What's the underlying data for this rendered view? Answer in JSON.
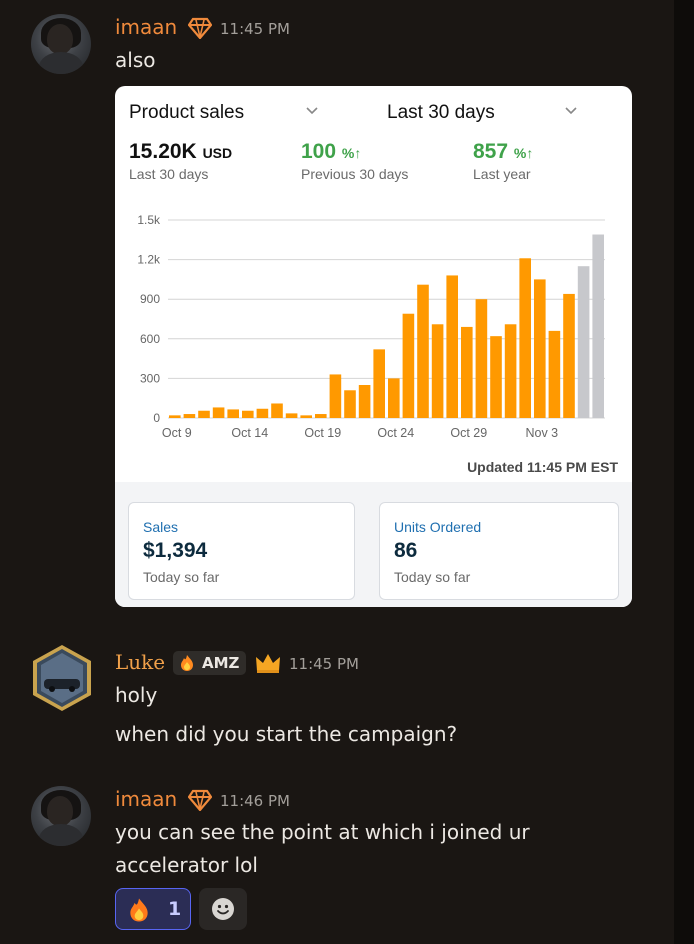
{
  "messages": [
    {
      "author": "imaan",
      "time": "11:45 PM",
      "lines": [
        "also"
      ]
    },
    {
      "author": "Luke",
      "tag": "AMZ",
      "time": "11:45 PM",
      "lines": [
        "holy",
        "when did you start the campaign?"
      ]
    },
    {
      "author": "imaan",
      "time": "11:46 PM",
      "lines": [
        "you can see the point at which i joined ur",
        "accelerator lol"
      ]
    }
  ],
  "attachment": {
    "metric_selector": "Product sales",
    "range_selector": "Last 30 days",
    "kpis": [
      {
        "value": "15.20K",
        "unit": "USD",
        "label": "Last 30 days"
      },
      {
        "value": "100",
        "unit": "%↑",
        "label": "Previous 30 days",
        "color": "#3fa24a"
      },
      {
        "value": "857",
        "unit": "%↑",
        "label": "Last year",
        "color": "#3fa24a"
      }
    ],
    "updated": "Updated 11:45 PM EST",
    "cards": [
      {
        "title": "Sales",
        "value": "$1,394",
        "sub": "Today so far"
      },
      {
        "title": "Units Ordered",
        "value": "86",
        "sub": "Today so far"
      }
    ]
  },
  "chart_data": {
    "type": "bar",
    "y_ticks": [
      "0",
      "300",
      "600",
      "900",
      "1.2k",
      "1.5k"
    ],
    "ylim": [
      0,
      1500
    ],
    "x_tick_labels": [
      "Oct 9",
      "Oct 14",
      "Oct 19",
      "Oct 24",
      "Oct 29",
      "Nov 3"
    ],
    "values": [
      20,
      30,
      55,
      80,
      65,
      55,
      70,
      110,
      35,
      20,
      30,
      330,
      210,
      250,
      520,
      300,
      790,
      1010,
      710,
      1080,
      690,
      900,
      620,
      710,
      1210,
      1050,
      660,
      940,
      1150,
      1390
    ],
    "bar_colors": {
      "actual": "#ff9900",
      "projected": "#c7c8cc"
    },
    "projected_count": 2,
    "grid": true
  },
  "reactions": [
    {
      "emoji": "fire",
      "count": "1"
    },
    {
      "emoji": "add-reaction"
    }
  ],
  "colors": {
    "imaan": "#f08a3c",
    "luke": "#f0a04a",
    "background": "#1a1613"
  }
}
